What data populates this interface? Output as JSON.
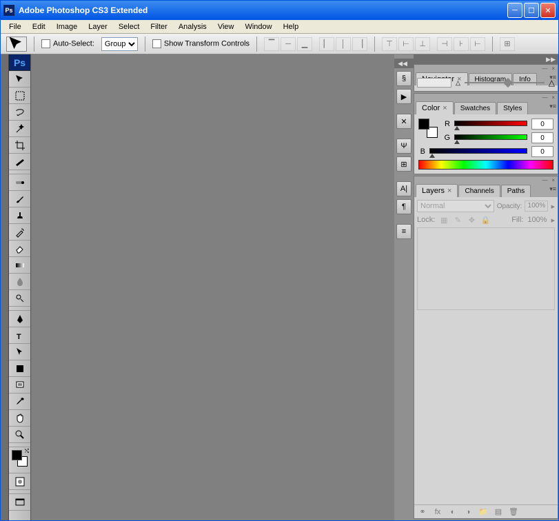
{
  "titlebar": {
    "title": "Adobe Photoshop CS3 Extended"
  },
  "menubar": [
    "File",
    "Edit",
    "Image",
    "Layer",
    "Select",
    "Filter",
    "Analysis",
    "View",
    "Window",
    "Help"
  ],
  "options": {
    "auto_select_label": "Auto-Select:",
    "auto_select_value": "Group",
    "show_transform_label": "Show Transform Controls"
  },
  "toolbox": {
    "badge": "Ps",
    "tools": [
      "move",
      "marquee",
      "lasso",
      "wand",
      "crop",
      "slice",
      "healing",
      "brush",
      "stamp",
      "history-brush",
      "eraser",
      "gradient",
      "blur",
      "dodge",
      "pen",
      "type",
      "path-select",
      "shape",
      "notes",
      "eyedropper",
      "hand",
      "zoom"
    ]
  },
  "panels": {
    "navigator": {
      "tabs": [
        "Navigator",
        "Histogram",
        "Info"
      ],
      "active": 0
    },
    "color": {
      "tabs": [
        "Color",
        "Swatches",
        "Styles"
      ],
      "active": 0,
      "channels": [
        {
          "label": "R",
          "value": "0"
        },
        {
          "label": "G",
          "value": "0"
        },
        {
          "label": "B",
          "value": "0"
        }
      ]
    },
    "layers": {
      "tabs": [
        "Layers",
        "Channels",
        "Paths"
      ],
      "active": 0,
      "blend_mode": "Normal",
      "opacity_label": "Opacity:",
      "opacity_value": "100%",
      "lock_label": "Lock:",
      "fill_label": "Fill:",
      "fill_value": "100%"
    }
  }
}
